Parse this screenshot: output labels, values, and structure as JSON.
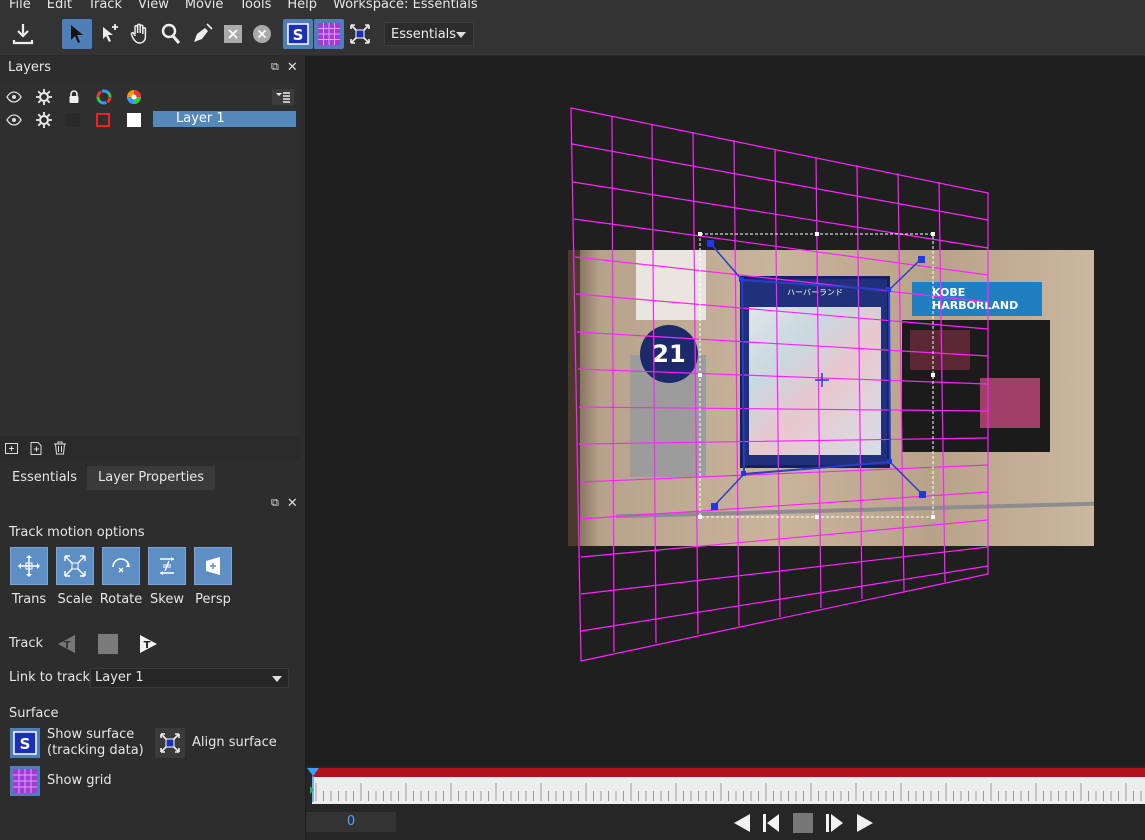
{
  "menu": [
    "File",
    "Edit",
    "Track",
    "View",
    "Movie",
    "Tools",
    "Help",
    "Workspace: Essentials"
  ],
  "toolbar": {
    "workspace_select": "Essentials",
    "tools": [
      "export-icon",
      "select-arrow-icon",
      "add-point-icon",
      "hand-icon",
      "zoom-icon",
      "pen-icon",
      "x-box-icon",
      "x-circle-icon",
      "surface-s-icon",
      "grid-icon",
      "align-surface-icon"
    ]
  },
  "layers_panel": {
    "title": "Layers",
    "layers": [
      {
        "name": "Layer 1"
      }
    ]
  },
  "props_tabs": [
    "Essentials",
    "Layer Properties"
  ],
  "properties": {
    "track_motion_title": "Track motion options",
    "motion_buttons": [
      "Trans",
      "Scale",
      "Rotate",
      "Skew",
      "Persp"
    ],
    "track_label": "Track",
    "link_label": "Link to track",
    "link_value": "Layer 1",
    "surface_title": "Surface",
    "show_surface_line1": "Show surface",
    "show_surface_line2": "(tracking data)",
    "align_surface": "Align surface",
    "show_grid": "Show grid"
  },
  "photo": {
    "circle_number": "21",
    "kobe_sign": "KOBE HARBORLAND",
    "map_header": "ハーバーランド"
  },
  "timeline": {
    "frame": "0"
  },
  "colors": {
    "accent": "#5588bb",
    "grid": "#ff22ff",
    "playhead": "#4aa3ff",
    "timeline_red": "#b3121b"
  }
}
